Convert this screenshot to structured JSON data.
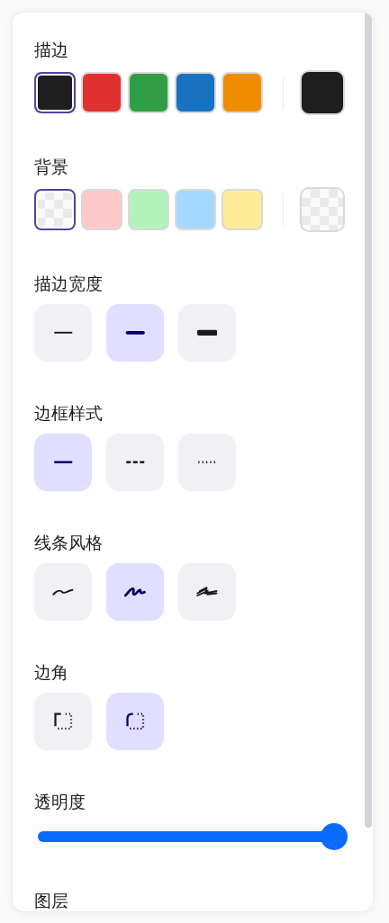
{
  "sections": [
    {
      "kind": "colors",
      "title": "描边",
      "swatches": [
        {
          "color": "#1e1e1e",
          "selected": true
        },
        {
          "color": "#e03131",
          "selected": false
        },
        {
          "color": "#2f9e44",
          "selected": false
        },
        {
          "color": "#1971c2",
          "selected": false
        },
        {
          "color": "#f08c00",
          "selected": false
        }
      ],
      "current": {
        "color": "#1e1e1e"
      }
    },
    {
      "kind": "colors",
      "title": "背景",
      "swatches": [
        {
          "kind": "transparent",
          "selected": true
        },
        {
          "color": "#ffc9c9",
          "selected": false
        },
        {
          "color": "#b2f2bb",
          "selected": false
        },
        {
          "color": "#a5d8ff",
          "selected": false
        },
        {
          "color": "#ffec99",
          "selected": false
        }
      ],
      "current": {
        "kind": "transparent"
      }
    },
    {
      "kind": "options",
      "title": "描边宽度",
      "options": [
        {
          "kind": "thin",
          "selected": false
        },
        {
          "kind": "bold",
          "selected": true
        },
        {
          "kind": "extra-bold",
          "selected": false
        }
      ]
    },
    {
      "kind": "options",
      "title": "边框样式",
      "options": [
        {
          "kind": "solid",
          "selected": true
        },
        {
          "kind": "dashed",
          "selected": false
        },
        {
          "kind": "dotted",
          "selected": false
        }
      ]
    },
    {
      "kind": "options",
      "title": "线条风格",
      "options": [
        {
          "kind": "architect",
          "selected": false
        },
        {
          "kind": "artist",
          "selected": true
        },
        {
          "kind": "cartoonist",
          "selected": false
        }
      ]
    },
    {
      "kind": "options",
      "title": "边角",
      "options": [
        {
          "kind": "sharp",
          "selected": false
        },
        {
          "kind": "round",
          "selected": true
        }
      ]
    },
    {
      "kind": "slider",
      "title": "透明度",
      "level": 1
    },
    {
      "kind": "heading",
      "title": "图层"
    }
  ]
}
